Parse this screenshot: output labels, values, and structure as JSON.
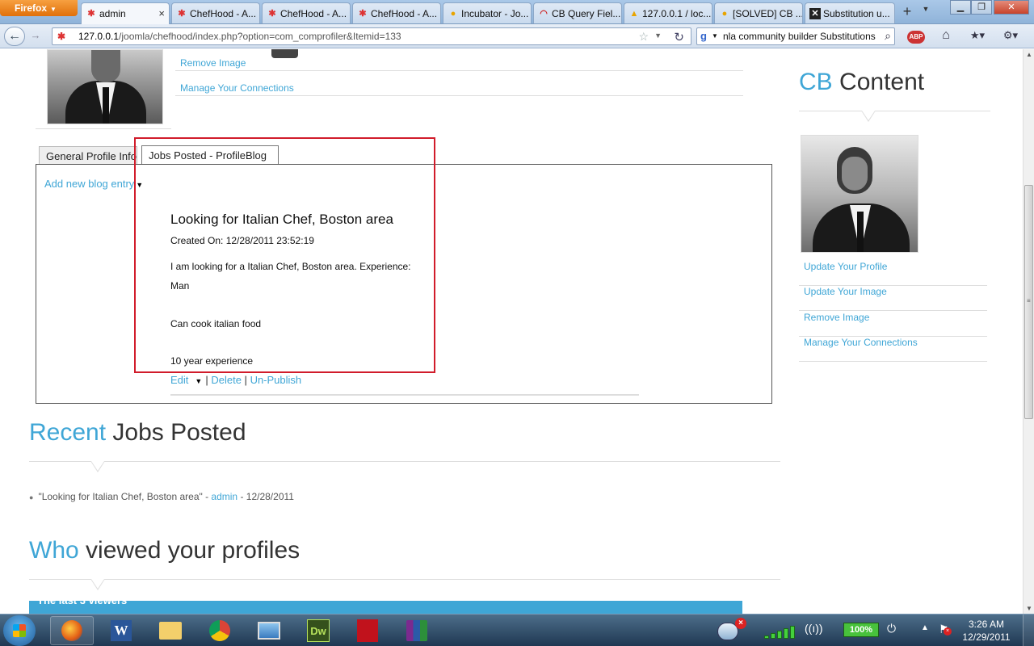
{
  "browser": {
    "menu_button": "Firefox",
    "tabs": [
      {
        "title": "admin",
        "icon": "joomla-icon",
        "active": true
      },
      {
        "title": "ChefHood - A...",
        "icon": "joomla-icon"
      },
      {
        "title": "ChefHood - A...",
        "icon": "joomla-icon"
      },
      {
        "title": "ChefHood - A...",
        "icon": "joomla-icon"
      },
      {
        "title": "Incubator - Jo...",
        "icon": "duck-icon"
      },
      {
        "title": "CB Query Fiel...",
        "icon": "arc-icon"
      },
      {
        "title": "127.0.0.1 / loc...",
        "icon": "phpmyadmin-icon"
      },
      {
        "title": "[SOLVED] CB ...",
        "icon": "duck-icon"
      },
      {
        "title": "Substitution u...",
        "icon": "x-icon"
      }
    ],
    "new_tab": "+",
    "address": {
      "host": "127.0.0.1",
      "path": "/joomla/chefhood/index.php?option=com_comprofiler&Itemid=133"
    },
    "search": {
      "value": "nla community builder Substitutions"
    },
    "abp_label": "ABP"
  },
  "page": {
    "top_links": [
      "Remove Image",
      "Manage Your Connections"
    ],
    "tabs": [
      {
        "label": "General Profile Info"
      },
      {
        "label": "Jobs Posted - ProfileBlog",
        "active": true
      }
    ],
    "add_blog_entry": "Add new blog entry",
    "post": {
      "title": "Looking for Italian Chef, Boston area",
      "created": "Created On: 12/28/2011 23:52:19",
      "body_lines": [
        "I am looking for a Italian Chef, Boston area. Experience:",
        "Man",
        "Can cook italian food",
        "10 year experience"
      ],
      "actions": {
        "edit": "Edit",
        "separator": "|",
        "delete": "Delete",
        "unpublish": "Un-Publish"
      }
    },
    "recent": {
      "heading_accent": "Recent",
      "heading_rest": "Jobs Posted",
      "item": {
        "title": "\"Looking for Italian Chef, Boston area\"",
        "sep1": " - ",
        "author": "admin",
        "sep2": " - ",
        "date": "12/28/2011"
      }
    },
    "who_viewed": {
      "heading_accent": "Who",
      "heading_rest": "viewed your profiles",
      "bar_label": "The last 3 viewers"
    },
    "sidebar": {
      "heading_accent": "CB",
      "heading_rest": "Content",
      "links": [
        "Update Your Profile",
        "Update Your Image",
        "Remove Image",
        "Manage Your Connections"
      ]
    }
  },
  "taskbar": {
    "apps": [
      "firefox",
      "word",
      "explorer",
      "chrome",
      "photo-viewer",
      "dreamweaver",
      "acrobat",
      "winrar"
    ],
    "word_letter": "W",
    "dw_label": "Dw",
    "battery": "100%",
    "time": "3:26 AM",
    "date": "12/29/2011"
  },
  "colors": {
    "accent": "#3fa6d6",
    "highlight": "#d11c2b"
  }
}
